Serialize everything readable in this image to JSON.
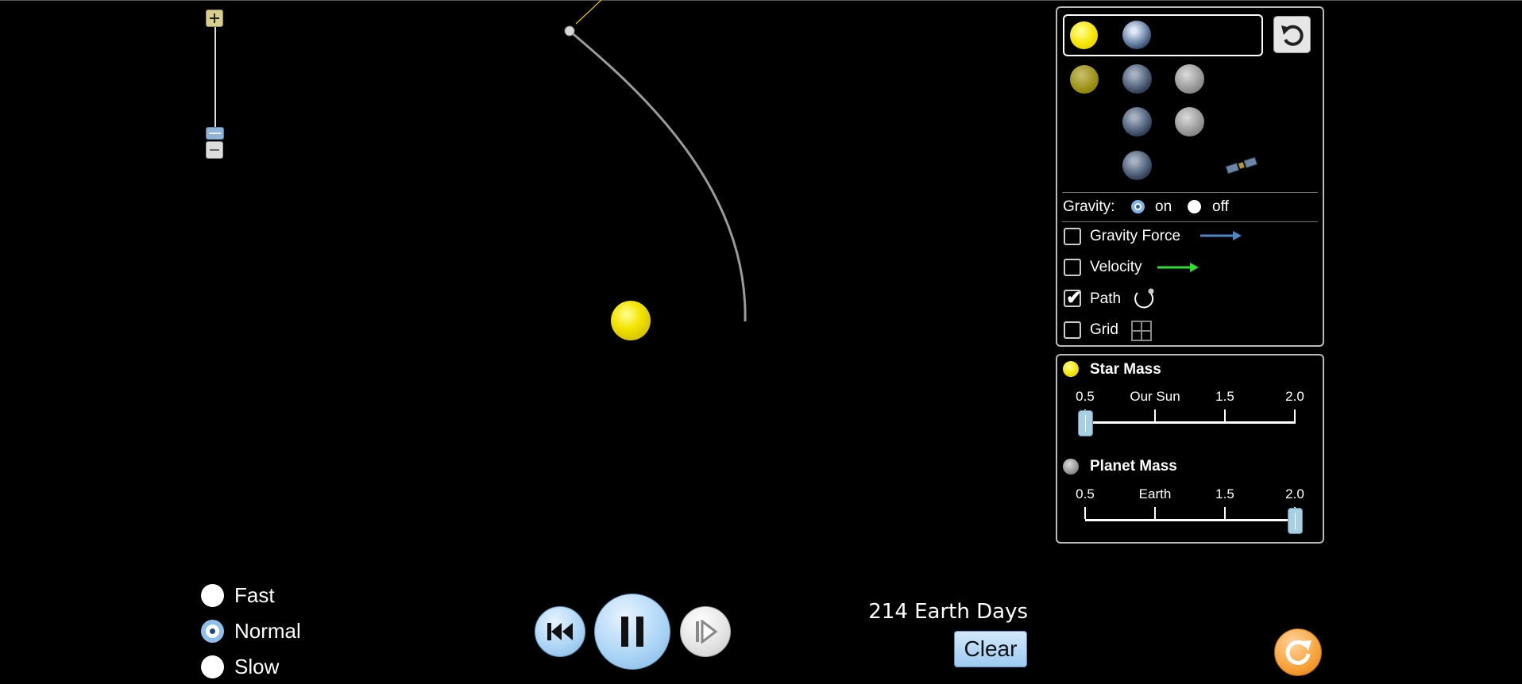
{
  "zoom": {
    "zoom_in_icon": "plus-icon",
    "zoom_out_icon": "minus-icon"
  },
  "presets": {
    "selected": [
      "star",
      "planet"
    ],
    "rows": [
      [
        "star",
        "planet",
        "moon"
      ],
      [
        "planet",
        "moon"
      ],
      [
        "planet",
        "satellite"
      ]
    ],
    "reset_icon": "undo-icon"
  },
  "gravity": {
    "label": "Gravity:",
    "on_label": "on",
    "off_label": "off",
    "selected": "on"
  },
  "options": {
    "gravity_force_label": "Gravity Force",
    "gravity_force_checked": false,
    "gravity_force_color": "#4a86c8",
    "velocity_label": "Velocity",
    "velocity_checked": false,
    "velocity_color": "#2ee02e",
    "path_label": "Path",
    "path_checked": true,
    "grid_label": "Grid",
    "grid_checked": false
  },
  "star_mass": {
    "title": "Star Mass",
    "ticks": [
      "0.5",
      "Our Sun",
      "1.5",
      "2.0"
    ],
    "value": 0.5,
    "min": 0.5,
    "max": 2.0
  },
  "planet_mass": {
    "title": "Planet Mass",
    "ticks": [
      "0.5",
      "Earth",
      "1.5",
      "2.0"
    ],
    "value": 2.0,
    "min": 0.5,
    "max": 2.0
  },
  "speed": {
    "options": [
      "Fast",
      "Normal",
      "Slow"
    ],
    "selected": "Normal"
  },
  "playback": {
    "rewind_icon": "rewind-icon",
    "pause_icon": "pause-icon",
    "step_icon": "step-forward-icon",
    "reset_all_icon": "reset-all-icon"
  },
  "readout": {
    "days": "214 Earth Days",
    "clear_label": "Clear"
  },
  "colors": {
    "star": "#f5e800",
    "path": "#9a9a9a",
    "accent": "#8ec0ec",
    "reset_orange": "#f5961e"
  }
}
